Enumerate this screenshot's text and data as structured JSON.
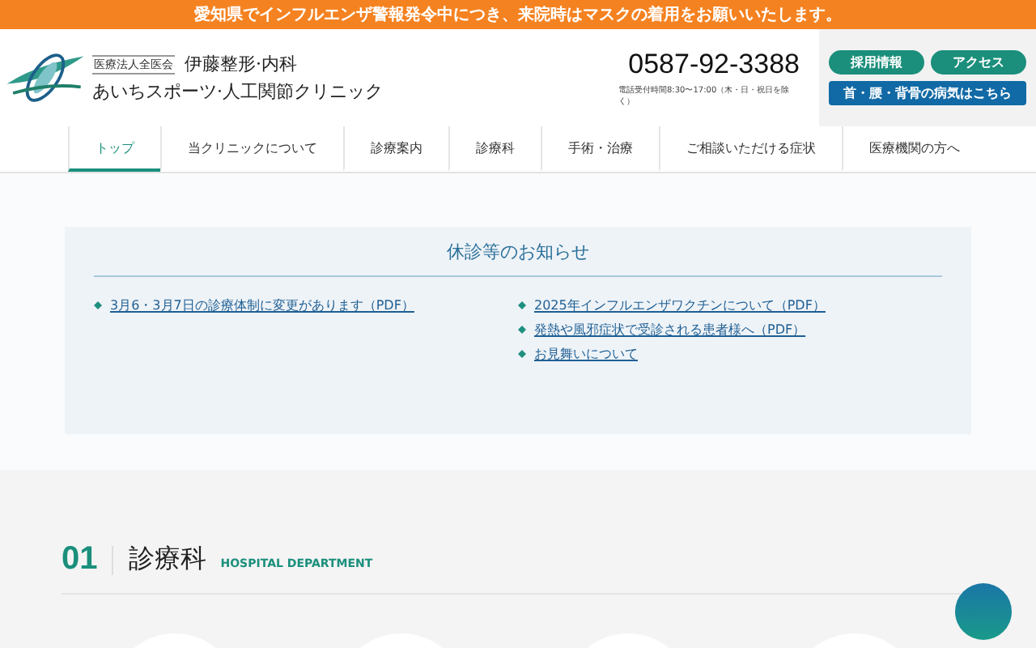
{
  "alert_bar": {
    "text": "愛知県でインフルエンザ警報発令中につき、来院時はマスクの着用をお願いいたします。"
  },
  "header": {
    "corporation": "医療法人全医会",
    "clinic_name_1": "伊藤整形·内科",
    "clinic_name_2": "あいちスポーツ·人工関節クリニック",
    "phone": "0587-92-3388",
    "hours": "電話受付時間8:30〜17:00（木・日・祝日を除く）",
    "buttons": [
      {
        "label": "採用情報",
        "kind": "pill"
      },
      {
        "label": "アクセス",
        "kind": "pill"
      },
      {
        "label": "首・腰・背骨の病気はこちら",
        "kind": "wide"
      }
    ]
  },
  "nav": [
    {
      "label": "トップ",
      "selected": true
    },
    {
      "label": "当クリニックについて",
      "selected": false
    },
    {
      "label": "診療案内",
      "selected": false
    },
    {
      "label": "診療科",
      "selected": false
    },
    {
      "label": "手術・治療",
      "selected": false
    },
    {
      "label": "ご相談いただける症状",
      "selected": false
    },
    {
      "label": "医療機関の方へ",
      "selected": false
    }
  ],
  "notice": {
    "title": "休診等のお知らせ",
    "left_links": [
      "3月6・3月7日の診療体制に変更があります（PDF）"
    ],
    "right_links": [
      "2025年インフルエンザワクチンについて（PDF）",
      "発熱や風邪症状で受診される患者様へ（PDF）",
      "お見舞いについて"
    ]
  },
  "section": {
    "number": "01",
    "title": "診療科",
    "subtitle": "HOSPITAL DEPARTMENT"
  }
}
